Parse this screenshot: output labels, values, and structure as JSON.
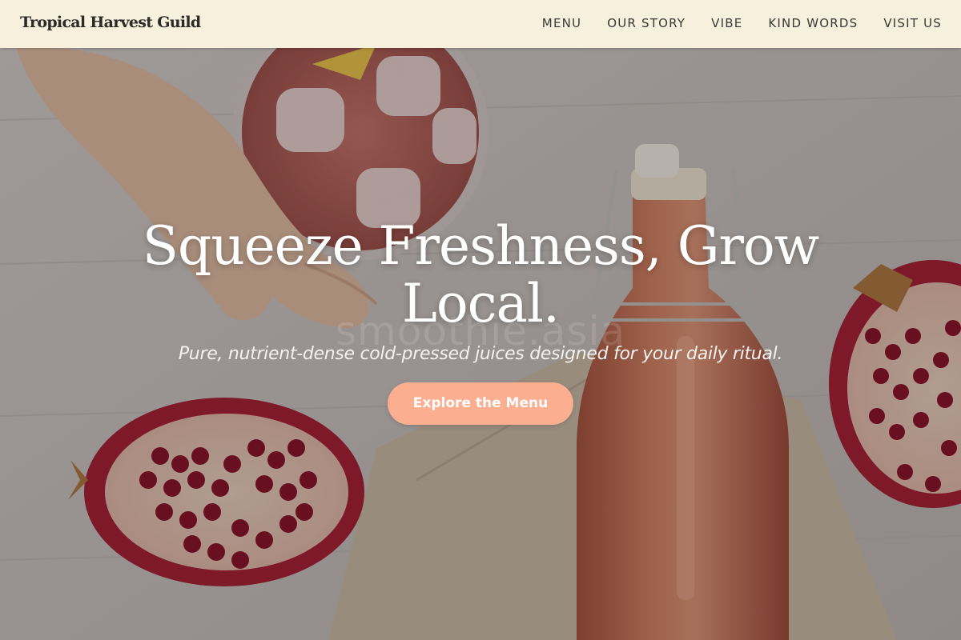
{
  "header": {
    "brand": "Tropical Harvest Guild",
    "nav": [
      {
        "label": "MENU"
      },
      {
        "label": "OUR STORY"
      },
      {
        "label": "VIBE"
      },
      {
        "label": "KIND WORDS"
      },
      {
        "label": "VISIT US"
      }
    ]
  },
  "hero": {
    "title": "Squeeze Freshness, Grow Local.",
    "subtitle": "Pure, nutrient-dense cold-pressed juices designed for your daily ritual.",
    "cta_label": "Explore the Menu",
    "watermark": "smoothie.asia"
  },
  "colors": {
    "nav_background": "#f6f0dc",
    "cta_background": "#fbae90",
    "brand_text": "#2b2a27",
    "hero_text": "#ffffff"
  }
}
